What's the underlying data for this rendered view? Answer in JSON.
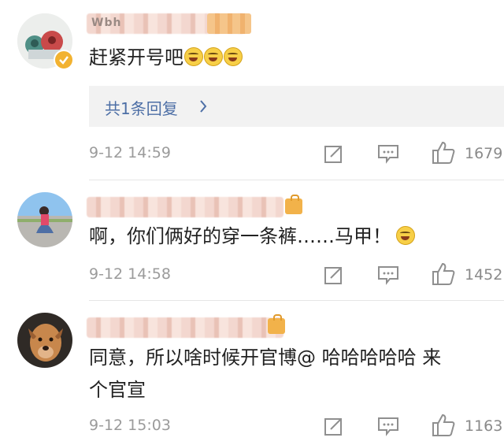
{
  "comments": [
    {
      "name_visible": "Wbh",
      "text": "赶紧开号吧",
      "reply_summary": "共1条回复",
      "time": "9-12 14:59",
      "likes": "1679",
      "emoji_count": 3
    },
    {
      "name_visible": "",
      "text": "啊，你们俩好的穿一条裤……马甲！",
      "time": "9-12 14:58",
      "likes": "1452",
      "emoji_count": 1
    },
    {
      "name_visible": "",
      "text_line1": "同意，所以啥时候开官博@ 哈哈哈哈哈 来",
      "text_line2": "个官宣",
      "time": "9-12 15:03",
      "likes": "1163"
    }
  ],
  "icons": {
    "share": "share-icon",
    "comment": "comment-icon",
    "like": "thumbs-up-icon",
    "verified": "verified-badge-icon",
    "chevron": "chevron-right-icon"
  },
  "colors": {
    "link_blue": "#4d6fa6",
    "verified_gold": "#f2b230",
    "meta_gray": "#9b9b9b"
  }
}
